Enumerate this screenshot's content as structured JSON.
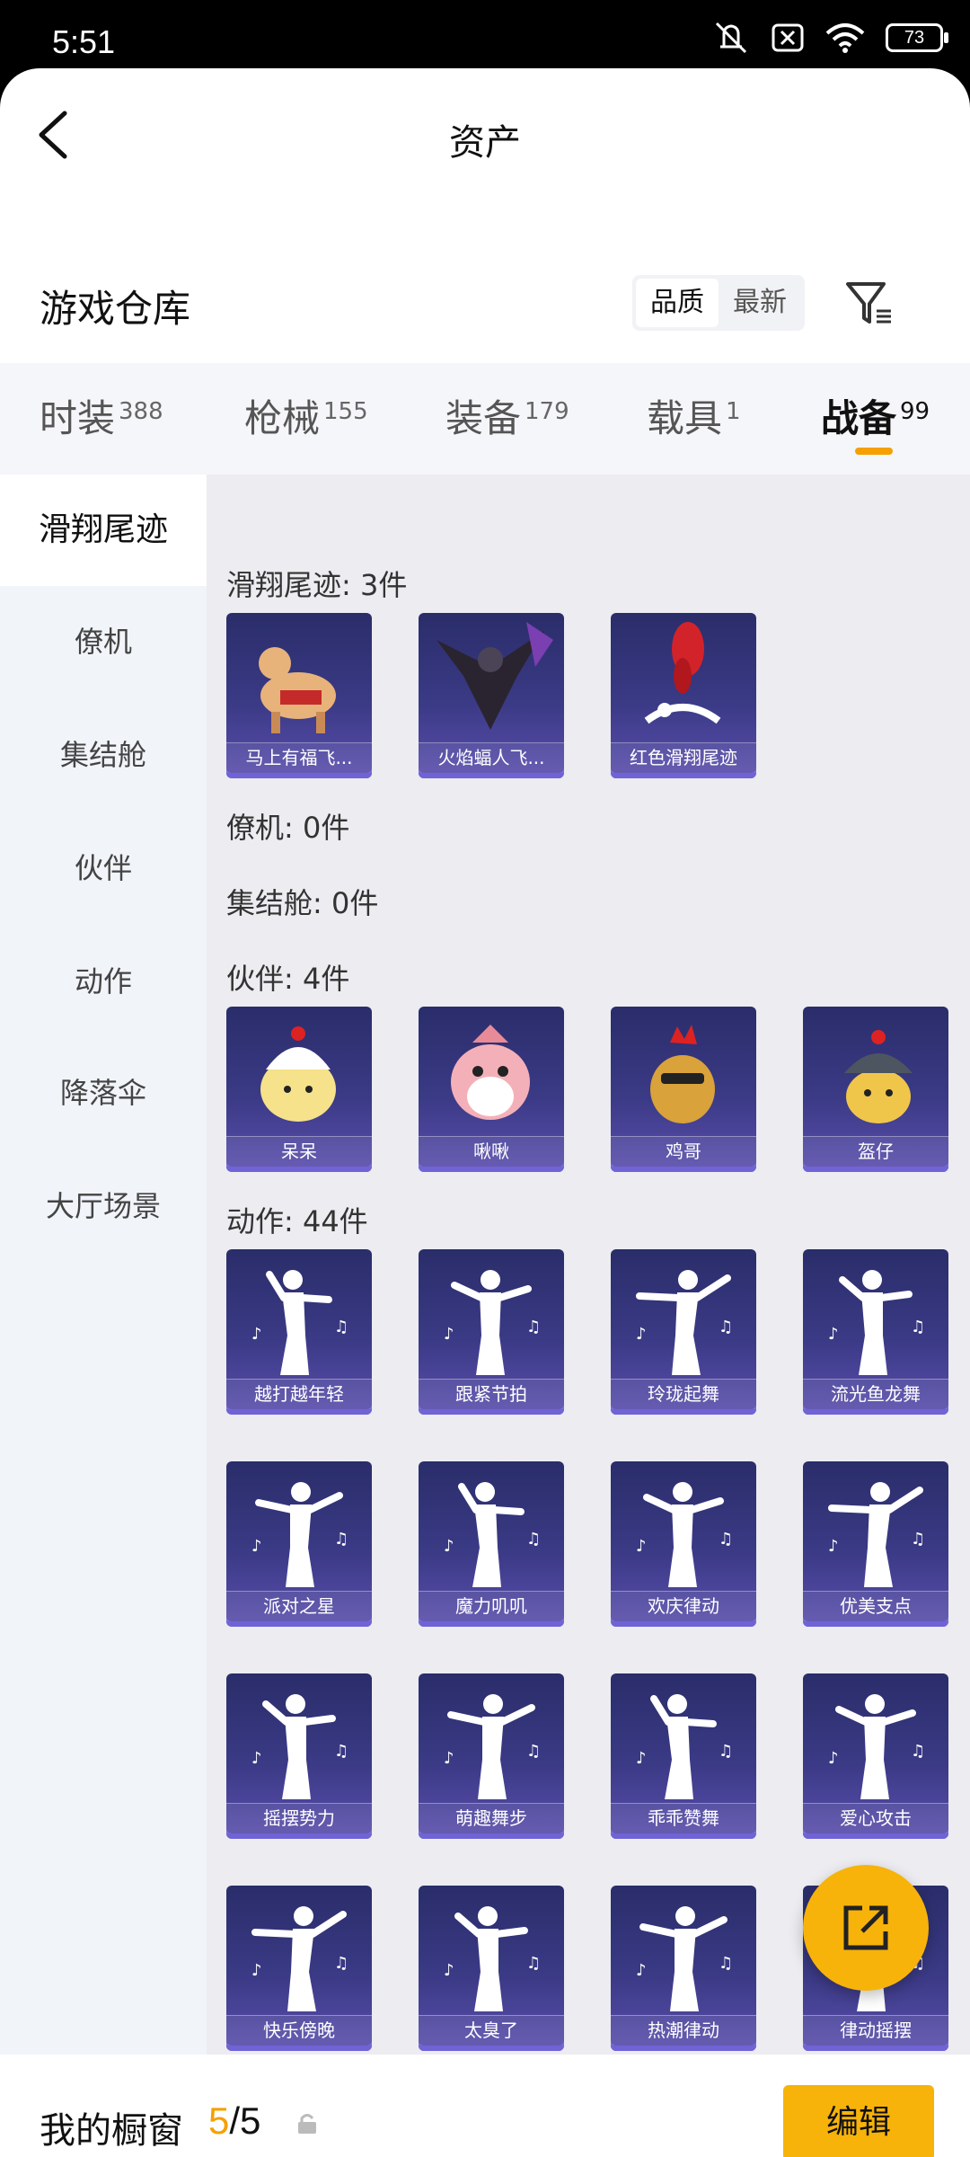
{
  "status": {
    "time": "5:51",
    "battery": "73"
  },
  "header": {
    "title": "资产"
  },
  "warehouse": {
    "title": "游戏仓库",
    "sort_quality": "品质",
    "sort_latest": "最新"
  },
  "tabs": [
    {
      "label": "时装",
      "count": "388"
    },
    {
      "label": "枪械",
      "count": "155"
    },
    {
      "label": "装备",
      "count": "179"
    },
    {
      "label": "载具",
      "count": "1"
    },
    {
      "label": "战备",
      "count": "99"
    }
  ],
  "sidebar": [
    "滑翔尾迹",
    "僚机",
    "集结舱",
    "伙伴",
    "动作",
    "降落伞",
    "大厅场景"
  ],
  "groups": {
    "glide": {
      "label": "滑翔尾迹: 3件",
      "items": [
        "马上有福飞...",
        "火焰蝠人飞...",
        "红色滑翔尾迹"
      ]
    },
    "wingman": {
      "label": "僚机: 0件"
    },
    "capsule": {
      "label": "集结舱: 0件"
    },
    "partner": {
      "label": "伙伴: 4件",
      "items": [
        "呆呆",
        "啾啾",
        "鸡哥",
        "盔仔"
      ]
    },
    "emote": {
      "label": "动作: 44件",
      "items": [
        "越打越年轻",
        "跟紧节拍",
        "玲珑起舞",
        "流光鱼龙舞",
        "派对之星",
        "魔力叽叽",
        "欢庆律动",
        "优美支点",
        "摇摆势力",
        "萌趣舞步",
        "乖乖赞舞",
        "爱心攻击",
        "快乐傍晚",
        "太臭了",
        "热潮律动",
        "律动摇摆"
      ]
    }
  },
  "bottom": {
    "label": "我的橱窗",
    "current": "5",
    "total": "/5",
    "edit": "编辑"
  },
  "colors": {
    "accent": "#f7b30a",
    "card_bg": "#3b3a86"
  }
}
